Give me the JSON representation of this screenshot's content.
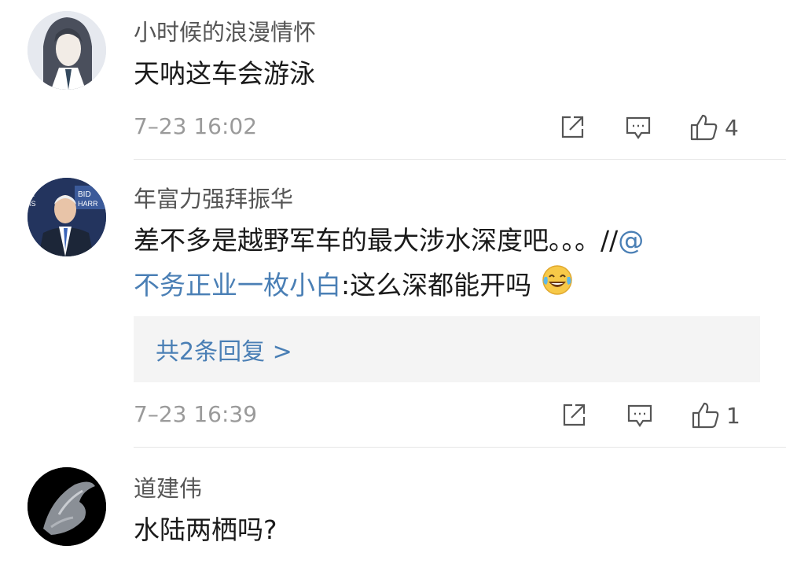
{
  "comments": [
    {
      "username": "小时候的浪漫情怀",
      "text": "天呐这车会游泳",
      "time": "7–23 16:02",
      "likes": "4"
    },
    {
      "username": "年富力强拜振华",
      "text_line1": "差不多是越野军车的最大涉水深度吧。。。//",
      "mention_at": "@",
      "mention_name": "不务正业一枚小白",
      "text_line2_rest": ":这么深都能开吗",
      "replies_label": "共2条回复 >",
      "time": "7–23 16:39",
      "likes": "1"
    },
    {
      "username": "道建伟",
      "text": "水陆两栖吗?"
    }
  ],
  "colors": {
    "link": "#4a7fb5",
    "muted": "#9a9a9a",
    "reply_bg": "#f4f4f4"
  },
  "icons": [
    "share-icon",
    "comment-icon",
    "thumbs-up-icon",
    "laughing-crying-emoji"
  ]
}
